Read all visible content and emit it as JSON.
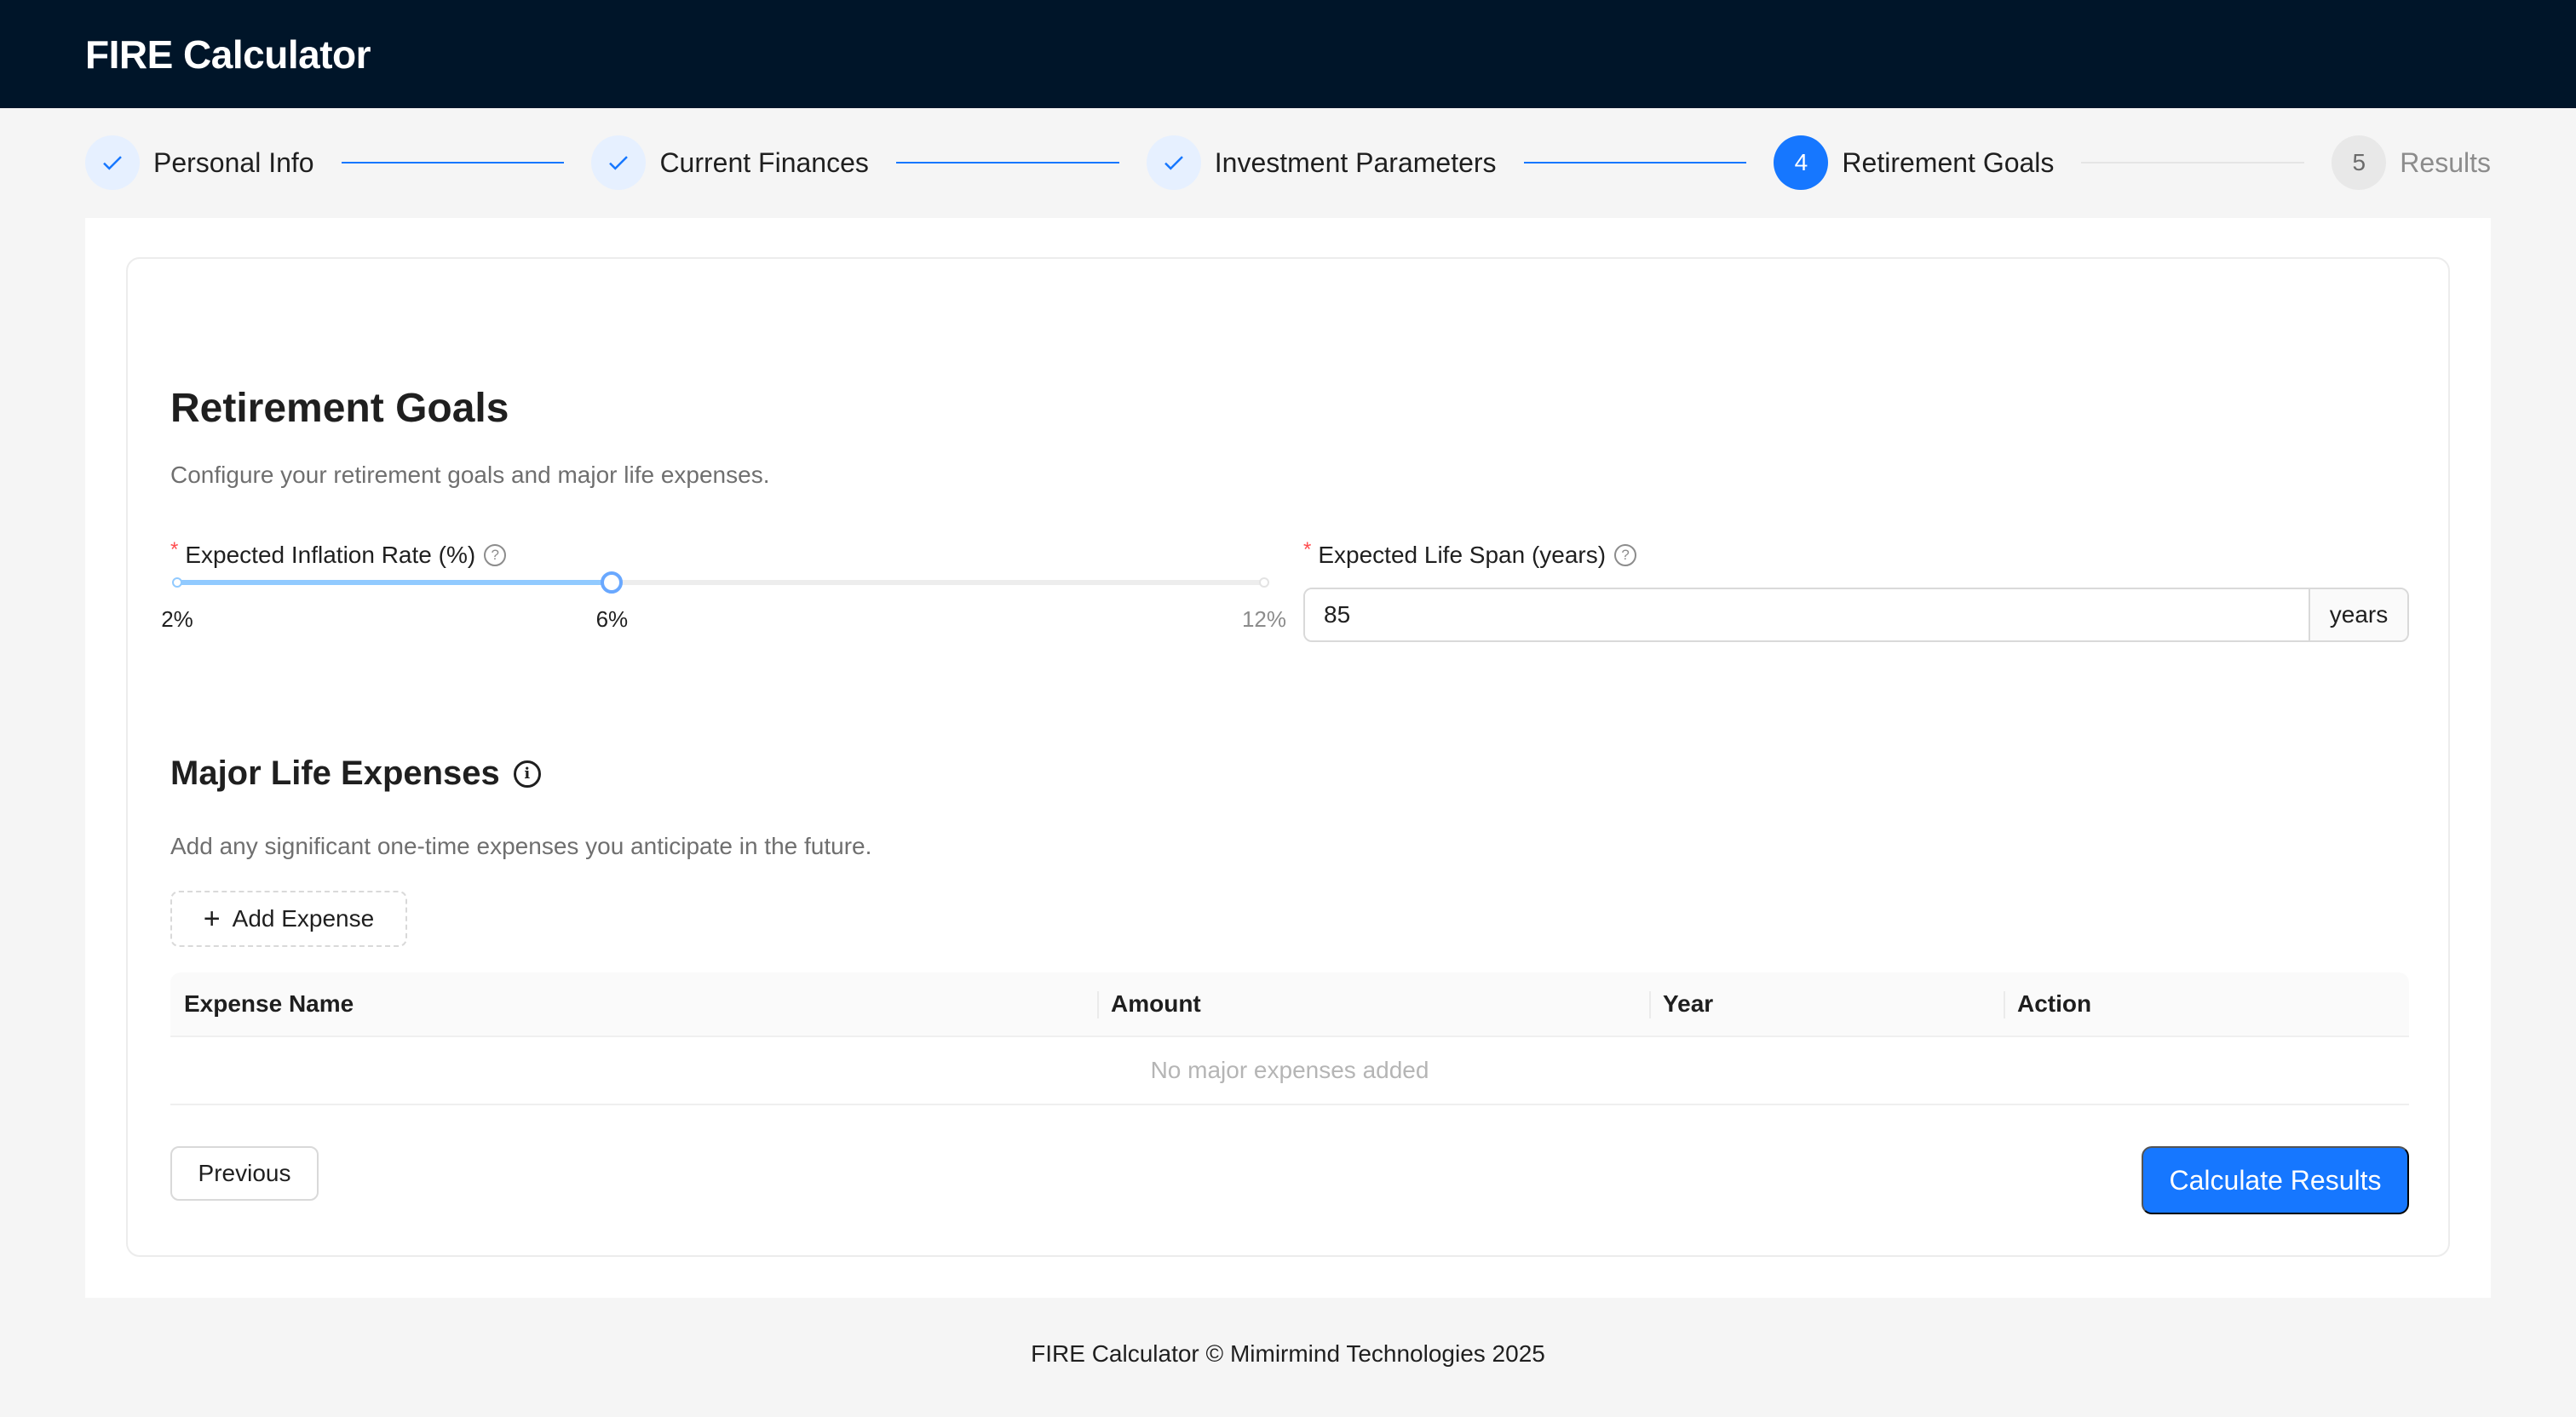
{
  "app": {
    "title": "FIRE Calculator"
  },
  "steps": [
    {
      "label": "Personal Info",
      "status": "done"
    },
    {
      "label": "Current Finances",
      "status": "done"
    },
    {
      "label": "Investment Parameters",
      "status": "done"
    },
    {
      "label": "Retirement Goals",
      "status": "active",
      "number": "4"
    },
    {
      "label": "Results",
      "status": "wait",
      "number": "5"
    }
  ],
  "section": {
    "title": "Retirement Goals",
    "description": "Configure your retirement goals and major life expenses."
  },
  "inflation": {
    "required_mark": "*",
    "label": "Expected Inflation Rate (%)",
    "min": 2,
    "max": 12,
    "value": 6,
    "marks": {
      "min": "2%",
      "value": "6%",
      "max": "12%"
    }
  },
  "lifespan": {
    "required_mark": "*",
    "label": "Expected Life Span (years)",
    "value": "85",
    "addon": "years"
  },
  "expenses": {
    "title": "Major Life Expenses",
    "description": "Add any significant one-time expenses you anticipate in the future.",
    "add_button": "Add Expense",
    "columns": [
      "Expense Name",
      "Amount",
      "Year",
      "Action"
    ],
    "empty_text": "No major expenses added"
  },
  "actions": {
    "previous": "Previous",
    "calculate": "Calculate Results"
  },
  "footer": {
    "text": "FIRE Calculator © Mimirmind Technologies 2025"
  },
  "colors": {
    "header_bg": "#001529",
    "primary": "#1677ff",
    "required": "#ff4d4f"
  }
}
